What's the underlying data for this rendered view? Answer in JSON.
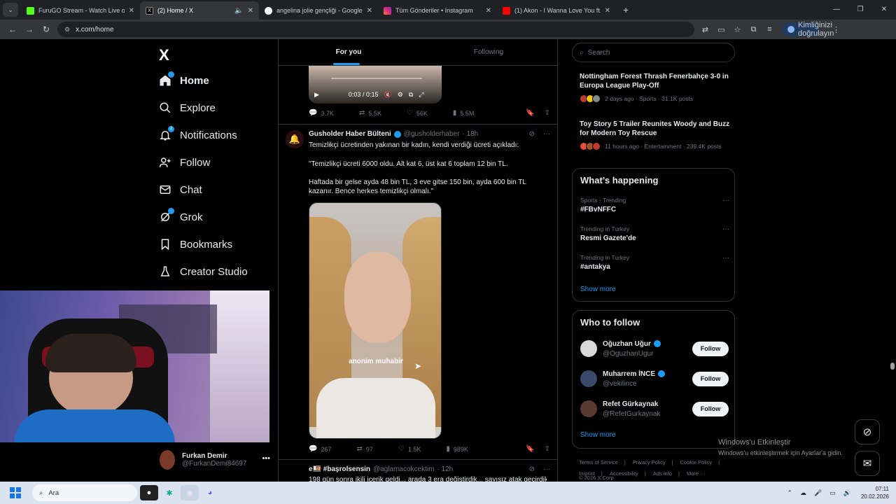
{
  "browser": {
    "tabs": [
      {
        "title": "FuruGO Stream - Watch Live on",
        "color": "#53fc18",
        "active": false
      },
      {
        "title": "(2) Home / X",
        "color": "#000000",
        "active": true
      },
      {
        "title": "angelina jolie gençliği - Google",
        "color": "#4285f4",
        "active": false
      },
      {
        "title": "Tüm Gönderiler • Instagram",
        "color": "#e1306c",
        "active": false
      },
      {
        "title": "(1) Akon - I Wanna Love You ft.",
        "color": "#ff0000",
        "active": false
      }
    ],
    "url": "x.com/home",
    "verify_label": "Kimliğinizi doğrulayın"
  },
  "nav": {
    "logo": "X",
    "items": [
      {
        "label": "Home",
        "icon": "home-icon"
      },
      {
        "label": "Explore",
        "icon": "search-icon"
      },
      {
        "label": "Notifications",
        "icon": "bell-icon",
        "badge": "2"
      },
      {
        "label": "Follow",
        "icon": "person-add-icon"
      },
      {
        "label": "Chat",
        "icon": "mail-icon"
      },
      {
        "label": "Grok",
        "icon": "grok-icon"
      },
      {
        "label": "Bookmarks",
        "icon": "bookmark-icon"
      },
      {
        "label": "Creator Studio",
        "icon": "flask-icon"
      }
    ],
    "profile": {
      "name": "Furkan Demir",
      "handle": "@FurkanDemi84697"
    }
  },
  "timeline": {
    "tabs": [
      "For you",
      "Following"
    ],
    "post1": {
      "video_time": "0:03 / 0:15",
      "stats": {
        "replies": "3.7K",
        "reposts": "5.5K",
        "likes": "56K",
        "views": "5.5M"
      }
    },
    "post2": {
      "name": "Gusholder Haber Bülteni",
      "handle": "@gusholderhaber",
      "time": "· 18h",
      "lines": [
        "Temizlikçi ücretinden yakınan bir kadın, kendi verdiği ücreti açıkladı:",
        "\"Temizlikçi ücreti 6000 oldu. Alt kat 6, üst kat 6 toplam 12 bin TL.",
        "Haftada bir gelse ayda 48 bin TL, 3 eve gitse 150 bin, ayda 600 bin TL kazanır. Bence herkes temizlikçi olmalı.\""
      ],
      "watermark": "anonim muhabir",
      "stats": {
        "replies": "267",
        "reposts": "97",
        "likes": "1.5K",
        "views": "989K"
      }
    },
    "post3": {
      "name": "e🍱 #başrolsensin",
      "handle": "@aglamacokcektim",
      "time": "· 12h",
      "text": "198 gün sonra ikili içerik geldi... arada 3 era değiştirdik... sayısız atak geçirdik..."
    }
  },
  "sidebar": {
    "search_placeholder": "Search",
    "trends_top": [
      {
        "title": "Nottingham Forest Thrash Fenerbahçe 3-0 in Europa League Play-Off",
        "meta": "2 days ago · Sports · 31.1K posts"
      },
      {
        "title": "Toy Story 5 Trailer Reunites Woody and Buzz for Modern Toy Rescue",
        "meta": "11 hours ago · Entertainment · 239.4K posts"
      }
    ],
    "whats_happening": {
      "title": "What’s happening",
      "items": [
        {
          "context": "Sports · Trending",
          "value": "#FBvNFFC"
        },
        {
          "context": "Trending in Turkey",
          "value": "Resmi Gazete'de"
        },
        {
          "context": "Trending in Turkey",
          "value": "#antakya"
        }
      ],
      "show_more": "Show more"
    },
    "who_to_follow": {
      "title": "Who to follow",
      "users": [
        {
          "name": "Oğuzhan Uğur",
          "handle": "@OguzhanUgur",
          "verified": true,
          "button": "Follow"
        },
        {
          "name": "Muharrem İNCE",
          "handle": "@vekilince",
          "verified": true,
          "button": "Follow"
        },
        {
          "name": "Refet Gürkaynak",
          "handle": "@RefetGurkaynak",
          "verified": false,
          "button": "Follow"
        }
      ],
      "show_more": "Show more"
    },
    "footer_links": [
      "Terms of Service",
      "Privacy Policy",
      "Cookie Policy",
      "Imprint",
      "Accessibility",
      "Ads info",
      "More ···"
    ],
    "copyright": "© 2026 X Corp."
  },
  "windows_activation": {
    "title": "Windows'u Etkinleştir",
    "subtitle": "Windows'u etkinleştirmek için Ayarlar'a gidin."
  },
  "taskbar": {
    "search_placeholder": "Ara",
    "time": "07:11",
    "date": "20.02.2026"
  }
}
